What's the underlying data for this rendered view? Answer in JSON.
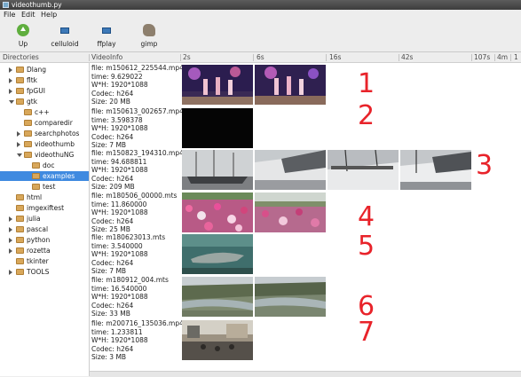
{
  "window": {
    "title": "videothumb.py"
  },
  "menu": {
    "file": "File",
    "edit": "Edit",
    "help": "Help"
  },
  "toolbar": {
    "up": "Up",
    "celluloid": "celluloid",
    "ffplay": "ffplay",
    "gimp": "gimp"
  },
  "columns": {
    "directories": "Directories",
    "videoinfo": "VideoInfo",
    "t1": "2s",
    "t2": "6s",
    "t3": "16s",
    "t4": "42s",
    "t5": "107s",
    "t6": "4m",
    "t7": "1"
  },
  "tree": [
    {
      "label": "Dlang"
    },
    {
      "label": "fltk"
    },
    {
      "label": "fpGUI"
    },
    {
      "label": "gtk"
    },
    {
      "label": "c++"
    },
    {
      "label": "comparedir"
    },
    {
      "label": "searchphotos"
    },
    {
      "label": "videothumb"
    },
    {
      "label": "videothuNG"
    },
    {
      "label": "doc"
    },
    {
      "label": "examples"
    },
    {
      "label": "test"
    },
    {
      "label": "html"
    },
    {
      "label": "imgexiftest"
    },
    {
      "label": "julia"
    },
    {
      "label": "pascal"
    },
    {
      "label": "python"
    },
    {
      "label": "rozetta"
    },
    {
      "label": "tkinter"
    },
    {
      "label": "TOOLS"
    }
  ],
  "videos": [
    {
      "file": "file: m150612_225544.mp4",
      "time": "time: 9.629022",
      "wh": "W*H: 1920*1088",
      "codec": "Codec: h264",
      "size": "Size: 20 MB",
      "marker": "1"
    },
    {
      "file": "file: m150613_002657.mp4",
      "time": "time: 3.598378",
      "wh": "W*H: 1920*1088",
      "codec": "Codec: h264",
      "size": "Size: 7 MB",
      "marker": "2"
    },
    {
      "file": "file: m150823_194310.mp4",
      "time": "time: 94.688811",
      "wh": "W*H: 1920*1088",
      "codec": "Codec: h264",
      "size": "Size: 209 MB",
      "marker": "3"
    },
    {
      "file": "file: m180506_00000.mts",
      "time": "time: 11.860000",
      "wh": "W*H: 1920*1088",
      "codec": "Codec: h264",
      "size": "Size: 25 MB",
      "marker": "4"
    },
    {
      "file": "file: m180623013.mts",
      "time": "time: 3.540000",
      "wh": "W*H: 1920*1088",
      "codec": "Codec: h264",
      "size": "Size: 7 MB",
      "marker": "5"
    },
    {
      "file": "file: m180912_004.mts",
      "time": "time: 16.540000",
      "wh": "W*H: 1920*1088",
      "codec": "Codec: h264",
      "size": "Size: 33 MB",
      "marker": "6"
    },
    {
      "file": "file: m200716_135036.mp4",
      "time": "time: 1.233811",
      "wh": "W*H: 1920*1088",
      "codec": "Codec: h264",
      "size": "Size: 3 MB",
      "marker": "7"
    }
  ]
}
